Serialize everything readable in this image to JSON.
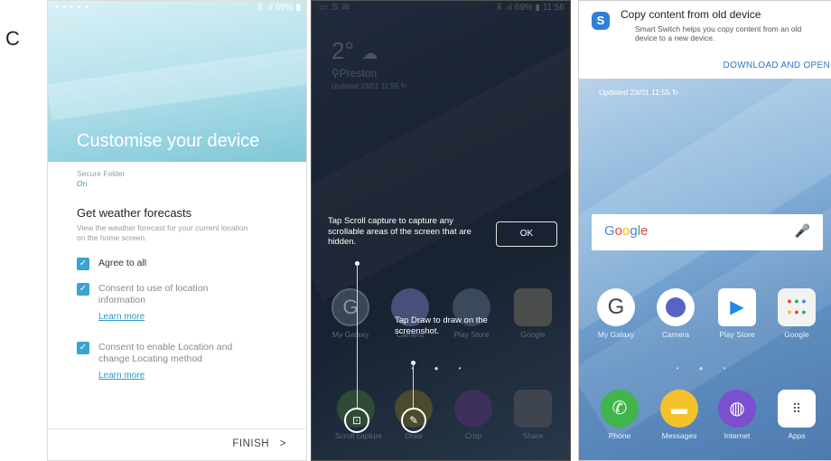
{
  "figure_label": "C",
  "panel1": {
    "status_bar": {
      "left": "• • • • •",
      "right": "⊼ .ıl 69% ▮"
    },
    "title": "Customise your device",
    "secure_folder_label": "Secure Folder",
    "secure_folder_value": "On",
    "weather_heading": "Get weather forecasts",
    "weather_desc": "View the weather forecast for your current location on the home screen.",
    "agree_all": "Agree to all",
    "consent_location": "Consent to use of location information",
    "consent_location_link": "Learn more",
    "consent_enable": "Consent to enable Location and change Locating method",
    "consent_enable_link": "Learn more",
    "finish_label": "FINISH",
    "finish_chevron": ">"
  },
  "panel2": {
    "status_bar": {
      "left": "▭ S ✉",
      "right": "⊼ .ıl 69% ▮ 11:56"
    },
    "temperature": "2°",
    "location": "Preston",
    "updated": "Updated 23/01 11:55",
    "scroll_tip": "Tap Scroll capture to capture any scrollable areas of the screen that are hidden.",
    "ok_label": "OK",
    "draw_tip": "Tap Draw to draw on the screenshot.",
    "apps_row1": [
      "My Galaxy",
      "Camera",
      "Play Store",
      "Google"
    ],
    "dock": [
      "Scroll capture",
      "Draw",
      "Crop",
      "Share"
    ]
  },
  "panel3": {
    "notif_title": "Copy content from old device",
    "notif_desc": "Smart Switch helps you copy content from an old device to a new device.",
    "notif_action": "DOWNLOAD AND OPEN",
    "notif_icon": "S",
    "updated": "Updated 23/01 11:55",
    "google_label": "Google",
    "apps_row1": [
      "My Galaxy",
      "Camera",
      "Play Store",
      "Google"
    ],
    "dock": [
      "Phone",
      "Messages",
      "Internet",
      "Apps"
    ]
  },
  "colors": {
    "checkbox": "#3aa3d1",
    "link": "#2f9ac0",
    "action_blue": "#2b78c8",
    "phone_green": "#3fb54a",
    "messages_yellow": "#f3c22b",
    "internet_purple": "#7a4fd0",
    "playstore": "#1e88e5"
  }
}
